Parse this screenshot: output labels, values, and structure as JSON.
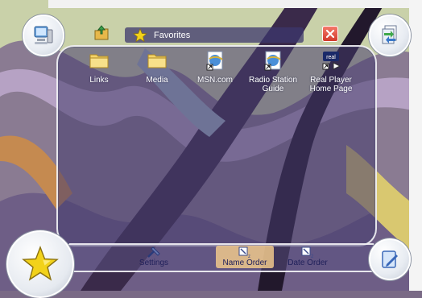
{
  "window": {
    "title": "Favorites"
  },
  "items": [
    {
      "label": "Links",
      "icon": "folder-icon"
    },
    {
      "label": "Media",
      "icon": "folder-icon"
    },
    {
      "label": "MSN.com",
      "icon": "internet-shortcut-icon"
    },
    {
      "label": "Radio Station Guide",
      "icon": "internet-shortcut-icon"
    },
    {
      "label": "Real Player Home Page",
      "icon": "realplayer-shortcut-icon"
    }
  ],
  "bottom_bar": {
    "settings_label": "Settings",
    "name_order_label": "Name Order",
    "date_order_label": "Date Order"
  },
  "colors": {
    "accent_star": "#f2d21a",
    "close_red": "#d23a2a"
  }
}
